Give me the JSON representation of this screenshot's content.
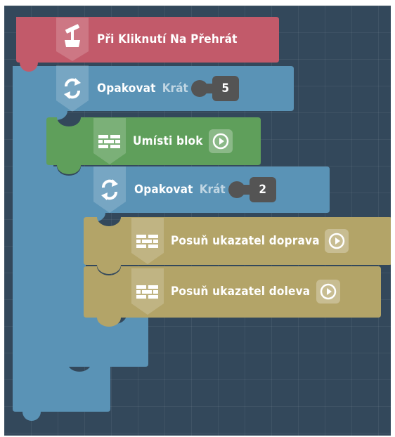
{
  "event_block": {
    "label": "Při Kliknutí Na Přehrát",
    "icon": "piston-icon",
    "color": "#c25a6a"
  },
  "outer_loop": {
    "label": "Opakovat",
    "times_label": "Krát",
    "count": "5",
    "icon": "repeat-icon",
    "color": "#5a93b6"
  },
  "place_block": {
    "label": "Umísti blok",
    "icon": "brick-icon",
    "color": "#5f9f5b"
  },
  "inner_loop": {
    "label": "Opakovat",
    "times_label": "Krát",
    "count": "2",
    "icon": "repeat-icon",
    "color": "#5a93b6"
  },
  "move_right": {
    "label": "Posuň ukazatel doprava",
    "icon": "brick-icon",
    "color": "#b3a468"
  },
  "move_left": {
    "label": "Posuň ukazatel doleva",
    "icon": "brick-icon",
    "color": "#b3a468"
  },
  "colors": {
    "canvas": "#33485b",
    "value_slot": "#545454",
    "mustard": "#b3a468",
    "blue": "#5a93b6",
    "green": "#5f9f5b",
    "red": "#c25a6a"
  }
}
